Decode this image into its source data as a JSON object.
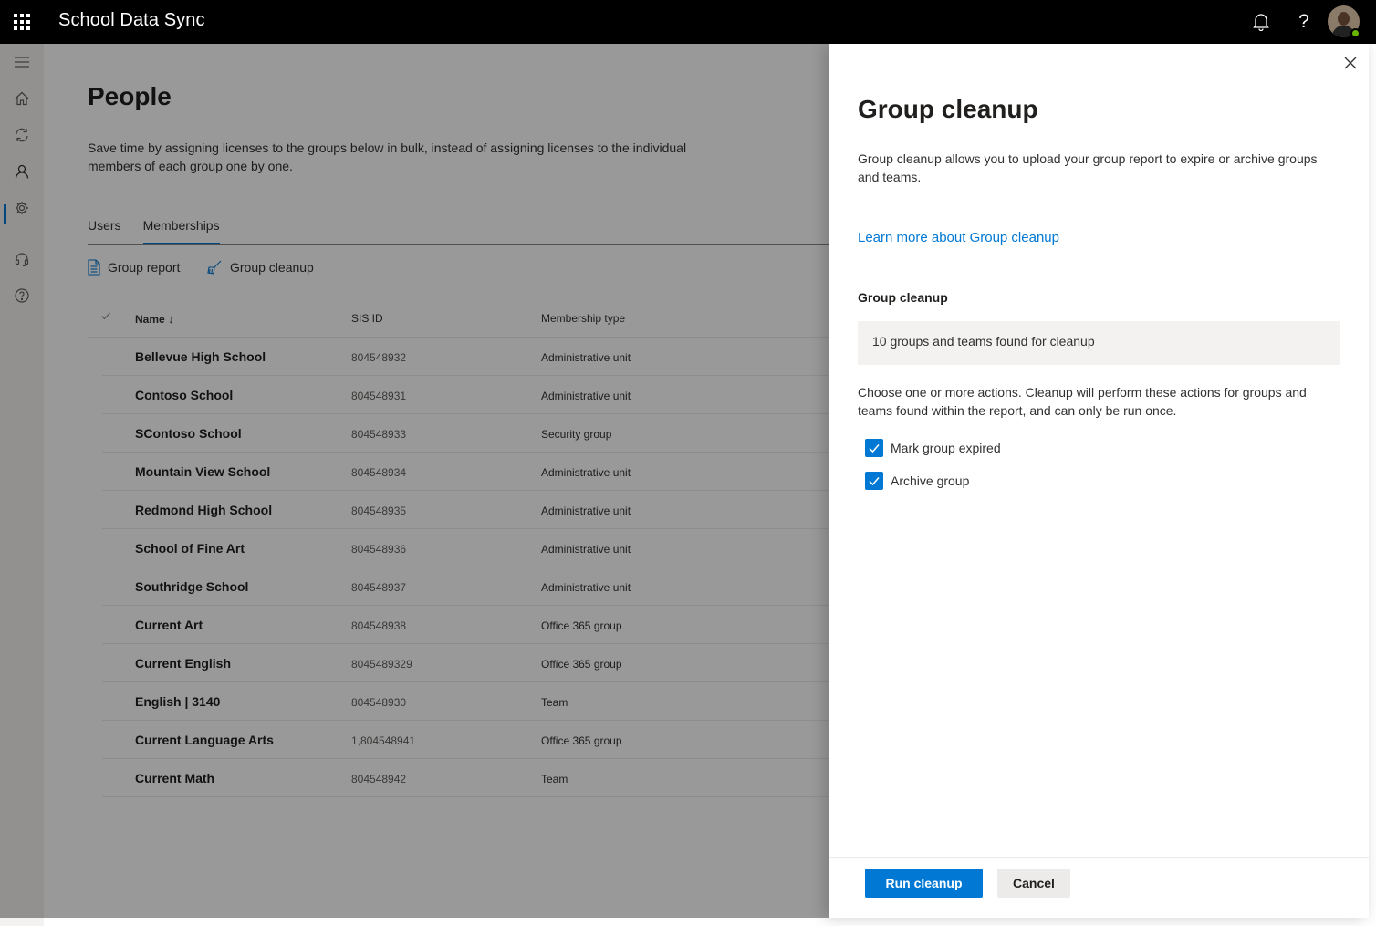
{
  "topbar": {
    "app_title": "School Data Sync",
    "icons": [
      "waffle-icon",
      "bell-icon",
      "help-icon",
      "avatar"
    ],
    "help_glyph": "?"
  },
  "rail": {
    "items": [
      "hamburger-icon",
      "home-icon",
      "sync-icon",
      "people-icon",
      "settings-icon",
      "headset-icon",
      "question-icon"
    ],
    "active": "people-icon"
  },
  "page": {
    "title": "People",
    "description": "Save time by assigning licenses to the groups below in bulk, instead of assigning licenses to the individual members of each group one by one.",
    "tabs": [
      {
        "label": "Users"
      },
      {
        "label": "Memberships"
      }
    ],
    "commands": {
      "group_report": "Group report",
      "group_cleanup": "Group cleanup"
    }
  },
  "table": {
    "columns": {
      "name": "Name",
      "sis_id": "SIS ID",
      "membership_type": "Membership type"
    },
    "rows": [
      {
        "name": "Bellevue High School",
        "sis_id": "804548932",
        "type": "Administrative unit"
      },
      {
        "name": "Contoso School",
        "sis_id": "804548931",
        "type": "Administrative unit"
      },
      {
        "name": "SContoso School",
        "sis_id": "804548933",
        "type": "Security group"
      },
      {
        "name": "Mountain View School",
        "sis_id": "804548934",
        "type": "Administrative unit"
      },
      {
        "name": "Redmond High School",
        "sis_id": "804548935",
        "type": "Administrative unit"
      },
      {
        "name": "School of Fine Art",
        "sis_id": "804548936",
        "type": "Administrative unit"
      },
      {
        "name": "Southridge School",
        "sis_id": "804548937",
        "type": "Administrative unit"
      },
      {
        "name": "Current Art",
        "sis_id": "804548938",
        "type": "Office 365 group"
      },
      {
        "name": "Current English",
        "sis_id": "8045489329",
        "type": "Office 365 group"
      },
      {
        "name": "English | 3140",
        "sis_id": "804548930",
        "type": "Team"
      },
      {
        "name": "Current Language Arts",
        "sis_id": "1,804548941",
        "type": "Office 365 group"
      },
      {
        "name": "Current Math",
        "sis_id": "804548942",
        "type": "Team"
      }
    ]
  },
  "panel": {
    "title": "Group cleanup",
    "description": "Group cleanup allows you to upload your group report to expire or archive groups and teams.",
    "learn_more": "Learn more about Group cleanup",
    "section_label": "Group cleanup",
    "found_text": "10 groups and teams found for cleanup",
    "instructions": "Choose one or more actions. Cleanup will perform these actions for groups and teams found within the report, and can only be run once.",
    "options": [
      {
        "label": "Mark group expired",
        "checked": true
      },
      {
        "label": "Archive group",
        "checked": true
      }
    ],
    "primary_button": "Run cleanup",
    "secondary_button": "Cancel"
  },
  "colors": {
    "accent": "#0078d4",
    "topbar": "#000000",
    "presence": "#6bb700"
  }
}
